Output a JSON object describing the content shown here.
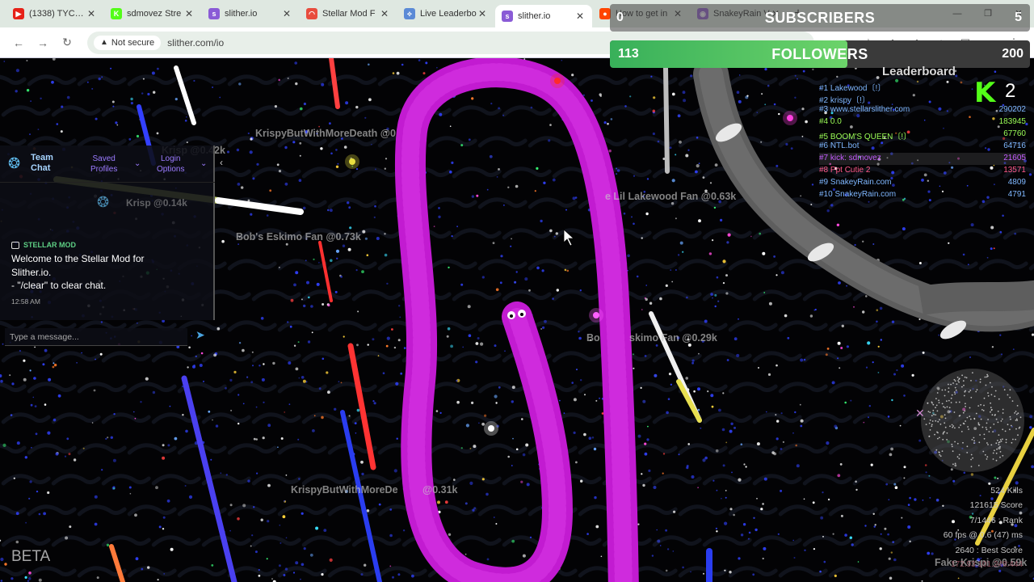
{
  "browser": {
    "tabs": [
      {
        "title": "(1338) TYC Jay",
        "color": "#e62117",
        "glyph": "▶"
      },
      {
        "title": "sdmovez Stre",
        "color": "#53fc18",
        "glyph": "K"
      },
      {
        "title": "slither.io",
        "color": "#8a5bd6",
        "glyph": "s"
      },
      {
        "title": "Stellar Mod F",
        "color": "#e84c3d",
        "glyph": "◠"
      },
      {
        "title": "Live Leaderbo",
        "color": "#5b8ad6",
        "glyph": "⟡"
      },
      {
        "title": "slither.io",
        "color": "#8a5bd6",
        "glyph": "s",
        "active": true
      },
      {
        "title": "How to get in",
        "color": "#ff4500",
        "glyph": "●"
      },
      {
        "title": "SnakeyRain V",
        "color": "#9c6bd6",
        "glyph": "◉"
      }
    ],
    "not_secure": "Not secure",
    "url": "slither.com/io"
  },
  "overlay": {
    "subscribers": {
      "label": "SUBSCRIBERS",
      "current": "0",
      "goal": "5"
    },
    "followers": {
      "label": "FOLLOWERS",
      "current": "113",
      "goal": "200",
      "progress": 0.565
    }
  },
  "leaderboard": {
    "title": "Leaderboard",
    "rows": [
      {
        "name": "#1 Lakewood〔!〕",
        "score": "",
        "color": "#7fb7ff"
      },
      {
        "name": "#2 krispy〔!〕",
        "score": "",
        "color": "#7fb7ff"
      },
      {
        "name": "#3 www.stellarslither.com",
        "score": "290202",
        "color": "#7fb7ff"
      },
      {
        "name": "#4 0.0",
        "score": "183945",
        "color": "#9cff57"
      },
      {
        "name": "#5 BOOM'S QUEEN〔!〕",
        "score": "67760",
        "color": "#9cff57"
      },
      {
        "name": "#6 NTL.bot",
        "score": "64716",
        "color": "#7fb7ff"
      },
      {
        "name": "#7 kick: sdmovez",
        "score": "21605",
        "color": "#c55cff"
      },
      {
        "name": "#8 Ppt Cutie 2",
        "score": "13571",
        "color": "#ff5a8a"
      },
      {
        "name": "#9 SnakeyRain.com",
        "score": "4809",
        "color": "#7fb7ff"
      },
      {
        "name": "#10 SnakeyRain.com",
        "score": "4791",
        "color": "#7fb7ff"
      }
    ]
  },
  "kick": {
    "glyph": "K",
    "count": "2"
  },
  "players": [
    "KrispyButWithMoreDeath @0",
    "Krisp @0.42k",
    "Krisp @0.14k",
    "Bob's Eskimo Fan @0.73k",
    "e Lil Lakewood Fan @0.63k",
    "Bo",
    "skimo Fan @0.29k",
    "KrispyButWithMoreDe",
    "@0.31k",
    "Fake Krispi @0.59k"
  ],
  "chat": {
    "tabs": {
      "team": "Team\nChat",
      "saved": "Saved\nProfiles",
      "login": "Login\nOptions"
    },
    "ghost": "Krisp @0.14k",
    "author": "STELLAR MOD",
    "message": "Welcome to the Stellar Mod for\nSlither.io.\n- \"/clear\" to clear chat.",
    "time": "12:58 AM",
    "placeholder": "Type a message..."
  },
  "stats": {
    "kills": "524 Kills",
    "score": "121615 Score",
    "rank": "7/1446 : Rank",
    "fps": "60 fps @ 0.6 (47) ms",
    "best": "2640 : Best Score",
    "ip": "172.93.101.248:444"
  },
  "beta": "BETA",
  "colors": {
    "snake": "#c21bd1",
    "snake_light": "#e040ec",
    "overlay_green": "#4cc25e"
  }
}
